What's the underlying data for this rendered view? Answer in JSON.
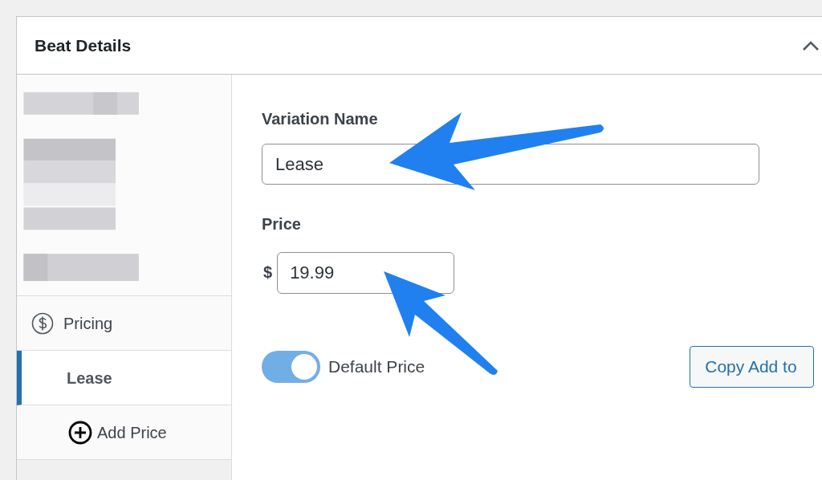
{
  "panel": {
    "title": "Beat Details",
    "expanded": true
  },
  "sidebar": {
    "items": [
      {
        "kind": "picture"
      },
      {
        "kind": "section",
        "label": "Pricing",
        "selected": false
      },
      {
        "kind": "variation",
        "label": "Lease",
        "selected": true
      },
      {
        "kind": "add",
        "label": "Add Price",
        "selected": false
      }
    ]
  },
  "form": {
    "variation_name": {
      "label": "Variation Name",
      "value": "Lease"
    },
    "price": {
      "label": "Price",
      "currency": "$",
      "value": "19.99"
    },
    "default_price": {
      "label": "Default Price",
      "on": true
    },
    "copy_button": "Copy Add to"
  }
}
